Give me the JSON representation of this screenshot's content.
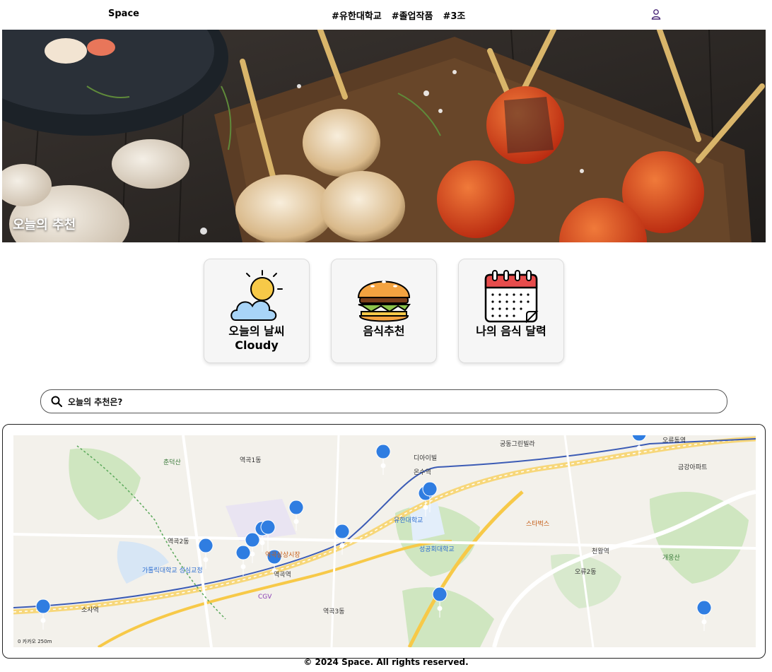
{
  "header": {
    "brand": "Space",
    "tags": [
      "#유한대학교",
      "#졸업작품",
      "#3조"
    ],
    "user_icon": "user-icon"
  },
  "hero": {
    "title": "오늘의 추천"
  },
  "cards": [
    {
      "title": "오늘의 날씨",
      "subtitle": "Cloudy",
      "icon": "weather-icon"
    },
    {
      "title": "음식추천",
      "icon": "burger-icon"
    },
    {
      "title": "나의 음식 달력",
      "icon": "calendar-icon"
    }
  ],
  "search": {
    "placeholder": "오늘의 추천은?",
    "icon": "search-icon"
  },
  "map": {
    "labels": [
      "역곡1동",
      "역곡2동",
      "역곡3동",
      "소사역",
      "온수역",
      "오류동역",
      "역곡역",
      "춘덕산",
      "유한대학교",
      "성공회대학교",
      "가톨릭대학교 성심교정",
      "궁동그린빌라",
      "역곡상상시장",
      "스타벅스",
      "CGV",
      "오류2동",
      "천왕역",
      "개웅산",
      "디아이빌",
      "금강아파트"
    ],
    "scale_text": "0 카카오 250m"
  },
  "footer": {
    "copyright": "© 2024 Space. All rights reserved."
  }
}
